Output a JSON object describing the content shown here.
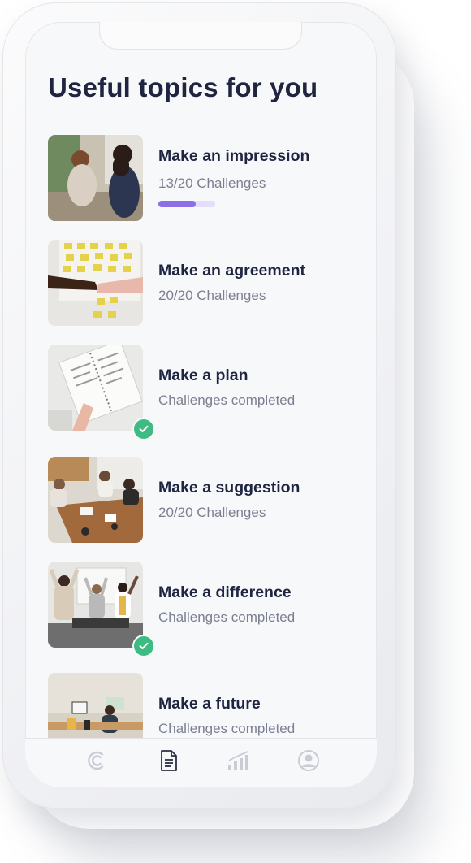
{
  "page": {
    "title": "Useful topics for you"
  },
  "topics": [
    {
      "title": "Make an impression",
      "subtitle": "13/20 Challenges",
      "progress": 0.65,
      "completed": false,
      "image": "two-women-talking-photo"
    },
    {
      "title": "Make an agreement",
      "subtitle": "20/20 Challenges",
      "completed": false,
      "image": "handshake-sticky-notes-photo"
    },
    {
      "title": "Make a plan",
      "subtitle": "Challenges completed",
      "completed": true,
      "image": "notebook-planning-photo"
    },
    {
      "title": "Make a suggestion",
      "subtitle": "20/20 Challenges",
      "completed": false,
      "image": "team-meeting-table-photo"
    },
    {
      "title": "Make a difference",
      "subtitle": "Challenges completed",
      "completed": true,
      "image": "team-celebrating-photo"
    },
    {
      "title": "Make a future",
      "subtitle": "Challenges completed",
      "completed": false,
      "image": "workshop-room-photo"
    }
  ],
  "tabbar": {
    "items": [
      {
        "icon": "app-logo-icon",
        "active": false
      },
      {
        "icon": "document-icon",
        "active": true
      },
      {
        "icon": "bar-chart-icon",
        "active": false
      },
      {
        "icon": "profile-icon",
        "active": false
      }
    ]
  },
  "colors": {
    "accent": "#8b6ee8",
    "accent_track": "#e3dffa",
    "success": "#3dbb83",
    "text_primary": "#1f2440",
    "text_secondary": "#7b7f91",
    "tab_inactive": "#c9ccd5",
    "tab_active": "#2b2f45"
  }
}
